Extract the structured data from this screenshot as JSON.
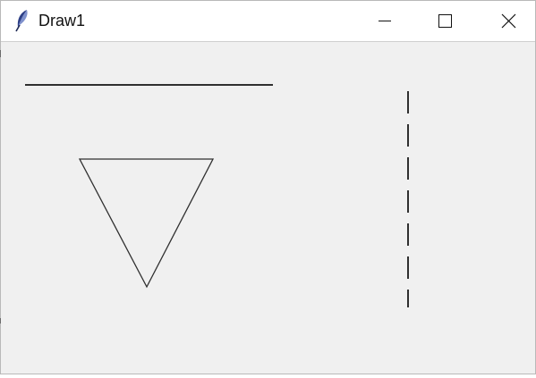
{
  "window": {
    "title": "Draw1"
  },
  "titlebar": {
    "app_icon": "feather-icon",
    "buttons": [
      {
        "name": "minimize",
        "icon": "minimize-icon"
      },
      {
        "name": "maximize",
        "icon": "maximize-icon"
      },
      {
        "name": "close",
        "icon": "close-icon"
      }
    ]
  },
  "canvas": {
    "background": "#f0f0f0",
    "stroke_color": "#2f2f2f",
    "shapes": [
      "horizontal-line",
      "inverted-triangle",
      "dashed-vertical-line"
    ]
  }
}
